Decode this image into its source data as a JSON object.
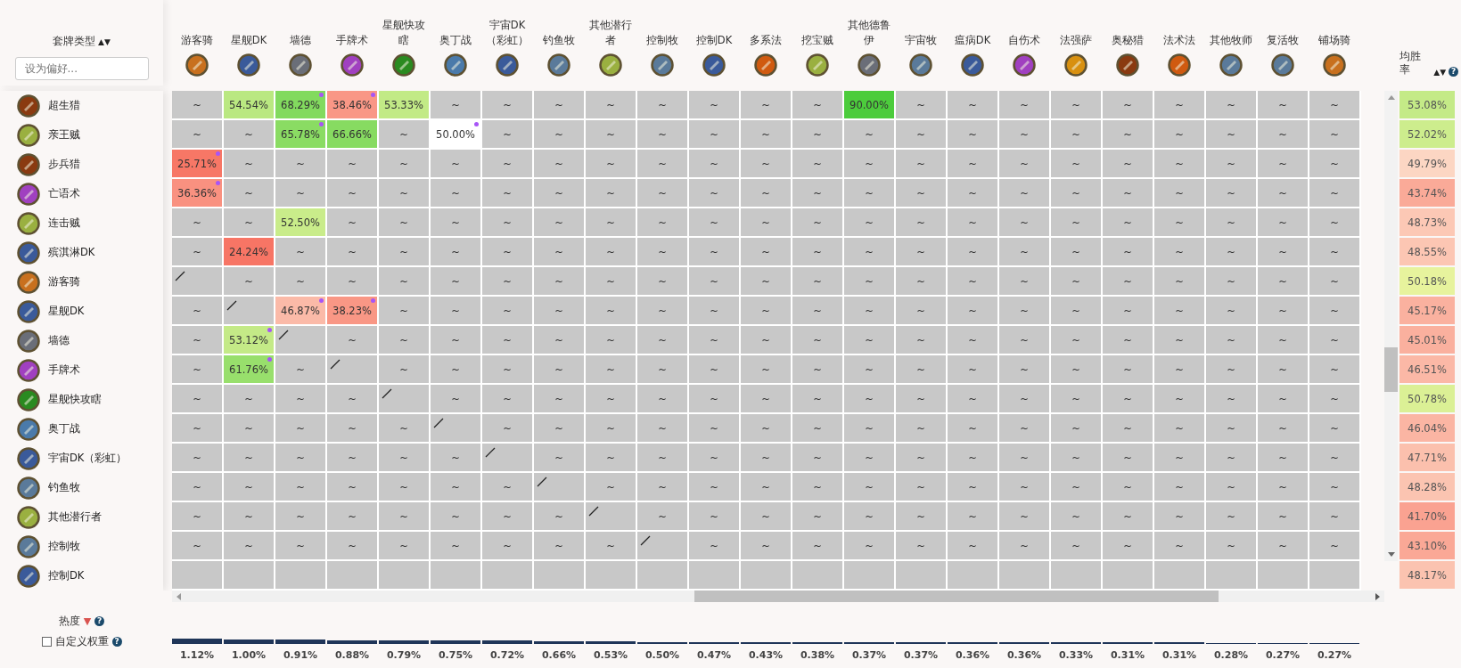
{
  "sidebar": {
    "title": "套牌类型",
    "sort_icon": "▲▼",
    "search": {
      "placeholder": "设为偏好..."
    },
    "popularity_label": "热度",
    "popularity_sort": "▼",
    "popularity_help": "?",
    "custom_weight": {
      "label": "自定义权重",
      "checked": false,
      "help": "?"
    }
  },
  "win_rate_header": {
    "label": "均胜率",
    "sort_icon": "▲▼",
    "help": "?"
  },
  "columns": [
    {
      "name": "游客骑",
      "color": "#c8701e",
      "popularity": "1.12%"
    },
    {
      "name": "星舰DK",
      "color": "#3a5a9a",
      "popularity": "1.00%"
    },
    {
      "name": "墙德",
      "color": "#6a6e78",
      "popularity": "0.91%"
    },
    {
      "name": "手牌术",
      "color": "#a040c0",
      "popularity": "0.88%"
    },
    {
      "name": "星舰快攻瞎",
      "color": "#2a8a20",
      "popularity": "0.79%"
    },
    {
      "name": "奥丁战",
      "color": "#4a7aaa",
      "popularity": "0.75%"
    },
    {
      "name": "宇宙DK（彩虹）",
      "color": "#3a5a9a",
      "popularity": "0.72%"
    },
    {
      "name": "钓鱼牧",
      "color": "#5a7a9a",
      "popularity": "0.66%"
    },
    {
      "name": "其他潜行者",
      "color": "#9ab040",
      "popularity": "0.53%"
    },
    {
      "name": "控制牧",
      "color": "#5a7a9a",
      "popularity": "0.50%"
    },
    {
      "name": "控制DK",
      "color": "#3a5a9a",
      "popularity": "0.47%"
    },
    {
      "name": "多系法",
      "color": "#d05a10",
      "popularity": "0.43%"
    },
    {
      "name": "挖宝贼",
      "color": "#9ab040",
      "popularity": "0.38%"
    },
    {
      "name": "其他德鲁伊",
      "color": "#6a6e78",
      "popularity": "0.37%"
    },
    {
      "name": "宇宙牧",
      "color": "#5a7a9a",
      "popularity": "0.37%"
    },
    {
      "name": "瘟病DK",
      "color": "#3a5a9a",
      "popularity": "0.36%"
    },
    {
      "name": "自伤术",
      "color": "#a040c0",
      "popularity": "0.36%"
    },
    {
      "name": "法强萨",
      "color": "#d89010",
      "popularity": "0.33%"
    },
    {
      "name": "奥秘猎",
      "color": "#8a3a10",
      "popularity": "0.31%"
    },
    {
      "name": "法术法",
      "color": "#d05a10",
      "popularity": "0.31%"
    },
    {
      "name": "其他牧师",
      "color": "#5a7a9a",
      "popularity": "0.28%"
    },
    {
      "name": "复活牧",
      "color": "#5a7a9a",
      "popularity": "0.27%"
    },
    {
      "name": "铺场骑",
      "color": "#c8701e",
      "popularity": "0.27%"
    }
  ],
  "rows": [
    {
      "name": "超生猎",
      "color": "#8a3a10",
      "win_rate": "53.08%",
      "cells": [
        {
          "text": "~",
          "dot": false
        },
        {
          "text": "54.54%",
          "dot": false
        },
        {
          "text": "68.29%",
          "dot": true
        },
        {
          "text": "38.46%",
          "dot": true
        },
        {
          "text": "53.33%",
          "dot": false
        },
        {
          "text": "~",
          "dot": false
        },
        {
          "text": "~",
          "dot": false
        },
        {
          "text": "~",
          "dot": false
        },
        {
          "text": "~",
          "dot": false
        },
        {
          "text": "~",
          "dot": false
        },
        {
          "text": "~",
          "dot": false
        },
        {
          "text": "~",
          "dot": false
        },
        {
          "text": "~",
          "dot": false
        },
        {
          "text": "90.00%",
          "dot": false
        },
        {
          "text": "~",
          "dot": false
        },
        {
          "text": "~",
          "dot": false
        },
        {
          "text": "~",
          "dot": false
        },
        {
          "text": "~",
          "dot": false
        },
        {
          "text": "~",
          "dot": false
        },
        {
          "text": "~",
          "dot": false
        },
        {
          "text": "~",
          "dot": false
        },
        {
          "text": "~",
          "dot": false
        },
        {
          "text": "~",
          "dot": false
        }
      ]
    },
    {
      "name": "亲王贼",
      "color": "#9ab040",
      "win_rate": "52.02%",
      "cells": [
        {
          "text": "~",
          "dot": false
        },
        {
          "text": "~",
          "dot": false
        },
        {
          "text": "65.78%",
          "dot": true
        },
        {
          "text": "66.66%",
          "dot": false
        },
        {
          "text": "~",
          "dot": false
        },
        {
          "text": "50.00%",
          "dot": true
        },
        {
          "text": "~",
          "dot": false
        },
        {
          "text": "~",
          "dot": false
        },
        {
          "text": "~",
          "dot": false
        },
        {
          "text": "~",
          "dot": false
        },
        {
          "text": "~",
          "dot": false
        },
        {
          "text": "~",
          "dot": false
        },
        {
          "text": "~",
          "dot": false
        },
        {
          "text": "~",
          "dot": false
        },
        {
          "text": "~",
          "dot": false
        },
        {
          "text": "~",
          "dot": false
        },
        {
          "text": "~",
          "dot": false
        },
        {
          "text": "~",
          "dot": false
        },
        {
          "text": "~",
          "dot": false
        },
        {
          "text": "~",
          "dot": false
        },
        {
          "text": "~",
          "dot": false
        },
        {
          "text": "~",
          "dot": false
        },
        {
          "text": "~",
          "dot": false
        }
      ]
    },
    {
      "name": "步兵猎",
      "color": "#8a3a10",
      "win_rate": "49.79%",
      "cells": [
        {
          "text": "25.71%",
          "dot": true
        },
        {
          "text": "~",
          "dot": false
        },
        {
          "text": "~",
          "dot": false
        },
        {
          "text": "~",
          "dot": false
        },
        {
          "text": "~",
          "dot": false
        },
        {
          "text": "~",
          "dot": false
        },
        {
          "text": "~",
          "dot": false
        },
        {
          "text": "~",
          "dot": false
        },
        {
          "text": "~",
          "dot": false
        },
        {
          "text": "~",
          "dot": false
        },
        {
          "text": "~",
          "dot": false
        },
        {
          "text": "~",
          "dot": false
        },
        {
          "text": "~",
          "dot": false
        },
        {
          "text": "~",
          "dot": false
        },
        {
          "text": "~",
          "dot": false
        },
        {
          "text": "~",
          "dot": false
        },
        {
          "text": "~",
          "dot": false
        },
        {
          "text": "~",
          "dot": false
        },
        {
          "text": "~",
          "dot": false
        },
        {
          "text": "~",
          "dot": false
        },
        {
          "text": "~",
          "dot": false
        },
        {
          "text": "~",
          "dot": false
        },
        {
          "text": "~",
          "dot": false
        }
      ]
    },
    {
      "name": "亡语术",
      "color": "#a040c0",
      "win_rate": "43.74%",
      "cells": [
        {
          "text": "36.36%",
          "dot": true
        },
        {
          "text": "~",
          "dot": false
        },
        {
          "text": "~",
          "dot": false
        },
        {
          "text": "~",
          "dot": false
        },
        {
          "text": "~",
          "dot": false
        },
        {
          "text": "~",
          "dot": false
        },
        {
          "text": "~",
          "dot": false
        },
        {
          "text": "~",
          "dot": false
        },
        {
          "text": "~",
          "dot": false
        },
        {
          "text": "~",
          "dot": false
        },
        {
          "text": "~",
          "dot": false
        },
        {
          "text": "~",
          "dot": false
        },
        {
          "text": "~",
          "dot": false
        },
        {
          "text": "~",
          "dot": false
        },
        {
          "text": "~",
          "dot": false
        },
        {
          "text": "~",
          "dot": false
        },
        {
          "text": "~",
          "dot": false
        },
        {
          "text": "~",
          "dot": false
        },
        {
          "text": "~",
          "dot": false
        },
        {
          "text": "~",
          "dot": false
        },
        {
          "text": "~",
          "dot": false
        },
        {
          "text": "~",
          "dot": false
        },
        {
          "text": "~",
          "dot": false
        }
      ]
    },
    {
      "name": "连击贼",
      "color": "#9ab040",
      "win_rate": "48.73%",
      "cells": [
        {
          "text": "~",
          "dot": false
        },
        {
          "text": "~",
          "dot": false
        },
        {
          "text": "52.50%",
          "dot": false
        },
        {
          "text": "~",
          "dot": false
        },
        {
          "text": "~",
          "dot": false
        },
        {
          "text": "~",
          "dot": false
        },
        {
          "text": "~",
          "dot": false
        },
        {
          "text": "~",
          "dot": false
        },
        {
          "text": "~",
          "dot": false
        },
        {
          "text": "~",
          "dot": false
        },
        {
          "text": "~",
          "dot": false
        },
        {
          "text": "~",
          "dot": false
        },
        {
          "text": "~",
          "dot": false
        },
        {
          "text": "~",
          "dot": false
        },
        {
          "text": "~",
          "dot": false
        },
        {
          "text": "~",
          "dot": false
        },
        {
          "text": "~",
          "dot": false
        },
        {
          "text": "~",
          "dot": false
        },
        {
          "text": "~",
          "dot": false
        },
        {
          "text": "~",
          "dot": false
        },
        {
          "text": "~",
          "dot": false
        },
        {
          "text": "~",
          "dot": false
        },
        {
          "text": "~",
          "dot": false
        }
      ]
    },
    {
      "name": "殡淇淋DK",
      "color": "#3a5a9a",
      "win_rate": "48.55%",
      "cells": [
        {
          "text": "~",
          "dot": false
        },
        {
          "text": "24.24%",
          "dot": false
        },
        {
          "text": "~",
          "dot": false
        },
        {
          "text": "~",
          "dot": false
        },
        {
          "text": "~",
          "dot": false
        },
        {
          "text": "~",
          "dot": false
        },
        {
          "text": "~",
          "dot": false
        },
        {
          "text": "~",
          "dot": false
        },
        {
          "text": "~",
          "dot": false
        },
        {
          "text": "~",
          "dot": false
        },
        {
          "text": "~",
          "dot": false
        },
        {
          "text": "~",
          "dot": false
        },
        {
          "text": "~",
          "dot": false
        },
        {
          "text": "~",
          "dot": false
        },
        {
          "text": "~",
          "dot": false
        },
        {
          "text": "~",
          "dot": false
        },
        {
          "text": "~",
          "dot": false
        },
        {
          "text": "~",
          "dot": false
        },
        {
          "text": "~",
          "dot": false
        },
        {
          "text": "~",
          "dot": false
        },
        {
          "text": "~",
          "dot": false
        },
        {
          "text": "~",
          "dot": false
        },
        {
          "text": "~",
          "dot": false
        }
      ]
    },
    {
      "name": "游客骑",
      "color": "#c8701e",
      "win_rate": "50.18%",
      "cells": [
        {
          "kind": "mirror",
          "dot": false
        },
        {
          "text": "~",
          "dot": false
        },
        {
          "text": "~",
          "dot": false
        },
        {
          "text": "~",
          "dot": false
        },
        {
          "text": "~",
          "dot": false
        },
        {
          "text": "~",
          "dot": false
        },
        {
          "text": "~",
          "dot": false
        },
        {
          "text": "~",
          "dot": false
        },
        {
          "text": "~",
          "dot": false
        },
        {
          "text": "~",
          "dot": false
        },
        {
          "text": "~",
          "dot": false
        },
        {
          "text": "~",
          "dot": false
        },
        {
          "text": "~",
          "dot": false
        },
        {
          "text": "~",
          "dot": false
        },
        {
          "text": "~",
          "dot": false
        },
        {
          "text": "~",
          "dot": false
        },
        {
          "text": "~",
          "dot": false
        },
        {
          "text": "~",
          "dot": false
        },
        {
          "text": "~",
          "dot": false
        },
        {
          "text": "~",
          "dot": false
        },
        {
          "text": "~",
          "dot": false
        },
        {
          "text": "~",
          "dot": false
        },
        {
          "text": "~",
          "dot": false
        }
      ]
    },
    {
      "name": "星舰DK",
      "color": "#3a5a9a",
      "win_rate": "45.17%",
      "cells": [
        {
          "text": "~",
          "dot": false
        },
        {
          "kind": "mirror",
          "dot": false
        },
        {
          "text": "46.87%",
          "dot": true
        },
        {
          "text": "38.23%",
          "dot": true
        },
        {
          "text": "~",
          "dot": false
        },
        {
          "text": "~",
          "dot": false
        },
        {
          "text": "~",
          "dot": false
        },
        {
          "text": "~",
          "dot": false
        },
        {
          "text": "~",
          "dot": false
        },
        {
          "text": "~",
          "dot": false
        },
        {
          "text": "~",
          "dot": false
        },
        {
          "text": "~",
          "dot": false
        },
        {
          "text": "~",
          "dot": false
        },
        {
          "text": "~",
          "dot": false
        },
        {
          "text": "~",
          "dot": false
        },
        {
          "text": "~",
          "dot": false
        },
        {
          "text": "~",
          "dot": false
        },
        {
          "text": "~",
          "dot": false
        },
        {
          "text": "~",
          "dot": false
        },
        {
          "text": "~",
          "dot": false
        },
        {
          "text": "~",
          "dot": false
        },
        {
          "text": "~",
          "dot": false
        },
        {
          "text": "~",
          "dot": false
        }
      ]
    },
    {
      "name": "墙德",
      "color": "#6a6e78",
      "win_rate": "45.01%",
      "cells": [
        {
          "text": "~",
          "dot": false
        },
        {
          "text": "53.12%",
          "dot": true
        },
        {
          "kind": "mirror",
          "dot": false
        },
        {
          "text": "~",
          "dot": false
        },
        {
          "text": "~",
          "dot": false
        },
        {
          "text": "~",
          "dot": false
        },
        {
          "text": "~",
          "dot": false
        },
        {
          "text": "~",
          "dot": false
        },
        {
          "text": "~",
          "dot": false
        },
        {
          "text": "~",
          "dot": false
        },
        {
          "text": "~",
          "dot": false
        },
        {
          "text": "~",
          "dot": false
        },
        {
          "text": "~",
          "dot": false
        },
        {
          "text": "~",
          "dot": false
        },
        {
          "text": "~",
          "dot": false
        },
        {
          "text": "~",
          "dot": false
        },
        {
          "text": "~",
          "dot": false
        },
        {
          "text": "~",
          "dot": false
        },
        {
          "text": "~",
          "dot": false
        },
        {
          "text": "~",
          "dot": false
        },
        {
          "text": "~",
          "dot": false
        },
        {
          "text": "~",
          "dot": false
        },
        {
          "text": "~",
          "dot": false
        }
      ]
    },
    {
      "name": "手牌术",
      "color": "#a040c0",
      "win_rate": "46.51%",
      "cells": [
        {
          "text": "~",
          "dot": false
        },
        {
          "text": "61.76%",
          "dot": true
        },
        {
          "text": "~",
          "dot": false
        },
        {
          "kind": "mirror",
          "dot": false
        },
        {
          "text": "~",
          "dot": false
        },
        {
          "text": "~",
          "dot": false
        },
        {
          "text": "~",
          "dot": false
        },
        {
          "text": "~",
          "dot": false
        },
        {
          "text": "~",
          "dot": false
        },
        {
          "text": "~",
          "dot": false
        },
        {
          "text": "~",
          "dot": false
        },
        {
          "text": "~",
          "dot": false
        },
        {
          "text": "~",
          "dot": false
        },
        {
          "text": "~",
          "dot": false
        },
        {
          "text": "~",
          "dot": false
        },
        {
          "text": "~",
          "dot": false
        },
        {
          "text": "~",
          "dot": false
        },
        {
          "text": "~",
          "dot": false
        },
        {
          "text": "~",
          "dot": false
        },
        {
          "text": "~",
          "dot": false
        },
        {
          "text": "~",
          "dot": false
        },
        {
          "text": "~",
          "dot": false
        },
        {
          "text": "~",
          "dot": false
        }
      ]
    },
    {
      "name": "星舰快攻瞎",
      "color": "#2a8a20",
      "win_rate": "50.78%",
      "cells": [
        {
          "text": "~",
          "dot": false
        },
        {
          "text": "~",
          "dot": false
        },
        {
          "text": "~",
          "dot": false
        },
        {
          "text": "~",
          "dot": false
        },
        {
          "kind": "mirror",
          "dot": false
        },
        {
          "text": "~",
          "dot": false
        },
        {
          "text": "~",
          "dot": false
        },
        {
          "text": "~",
          "dot": false
        },
        {
          "text": "~",
          "dot": false
        },
        {
          "text": "~",
          "dot": false
        },
        {
          "text": "~",
          "dot": false
        },
        {
          "text": "~",
          "dot": false
        },
        {
          "text": "~",
          "dot": false
        },
        {
          "text": "~",
          "dot": false
        },
        {
          "text": "~",
          "dot": false
        },
        {
          "text": "~",
          "dot": false
        },
        {
          "text": "~",
          "dot": false
        },
        {
          "text": "~",
          "dot": false
        },
        {
          "text": "~",
          "dot": false
        },
        {
          "text": "~",
          "dot": false
        },
        {
          "text": "~",
          "dot": false
        },
        {
          "text": "~",
          "dot": false
        },
        {
          "text": "~",
          "dot": false
        }
      ]
    },
    {
      "name": "奥丁战",
      "color": "#4a7aaa",
      "win_rate": "46.04%",
      "cells": [
        {
          "text": "~",
          "dot": false
        },
        {
          "text": "~",
          "dot": false
        },
        {
          "text": "~",
          "dot": false
        },
        {
          "text": "~",
          "dot": false
        },
        {
          "text": "~",
          "dot": false
        },
        {
          "kind": "mirror",
          "dot": false
        },
        {
          "text": "~",
          "dot": false
        },
        {
          "text": "~",
          "dot": false
        },
        {
          "text": "~",
          "dot": false
        },
        {
          "text": "~",
          "dot": false
        },
        {
          "text": "~",
          "dot": false
        },
        {
          "text": "~",
          "dot": false
        },
        {
          "text": "~",
          "dot": false
        },
        {
          "text": "~",
          "dot": false
        },
        {
          "text": "~",
          "dot": false
        },
        {
          "text": "~",
          "dot": false
        },
        {
          "text": "~",
          "dot": false
        },
        {
          "text": "~",
          "dot": false
        },
        {
          "text": "~",
          "dot": false
        },
        {
          "text": "~",
          "dot": false
        },
        {
          "text": "~",
          "dot": false
        },
        {
          "text": "~",
          "dot": false
        },
        {
          "text": "~",
          "dot": false
        }
      ]
    },
    {
      "name": "宇宙DK（彩虹）",
      "color": "#3a5a9a",
      "win_rate": "47.71%",
      "cells": [
        {
          "text": "~",
          "dot": false
        },
        {
          "text": "~",
          "dot": false
        },
        {
          "text": "~",
          "dot": false
        },
        {
          "text": "~",
          "dot": false
        },
        {
          "text": "~",
          "dot": false
        },
        {
          "text": "~",
          "dot": false
        },
        {
          "kind": "mirror",
          "dot": false
        },
        {
          "text": "~",
          "dot": false
        },
        {
          "text": "~",
          "dot": false
        },
        {
          "text": "~",
          "dot": false
        },
        {
          "text": "~",
          "dot": false
        },
        {
          "text": "~",
          "dot": false
        },
        {
          "text": "~",
          "dot": false
        },
        {
          "text": "~",
          "dot": false
        },
        {
          "text": "~",
          "dot": false
        },
        {
          "text": "~",
          "dot": false
        },
        {
          "text": "~",
          "dot": false
        },
        {
          "text": "~",
          "dot": false
        },
        {
          "text": "~",
          "dot": false
        },
        {
          "text": "~",
          "dot": false
        },
        {
          "text": "~",
          "dot": false
        },
        {
          "text": "~",
          "dot": false
        },
        {
          "text": "~",
          "dot": false
        }
      ]
    },
    {
      "name": "钓鱼牧",
      "color": "#5a7a9a",
      "win_rate": "48.28%",
      "cells": [
        {
          "text": "~",
          "dot": false
        },
        {
          "text": "~",
          "dot": false
        },
        {
          "text": "~",
          "dot": false
        },
        {
          "text": "~",
          "dot": false
        },
        {
          "text": "~",
          "dot": false
        },
        {
          "text": "~",
          "dot": false
        },
        {
          "text": "~",
          "dot": false
        },
        {
          "kind": "mirror",
          "dot": false
        },
        {
          "text": "~",
          "dot": false
        },
        {
          "text": "~",
          "dot": false
        },
        {
          "text": "~",
          "dot": false
        },
        {
          "text": "~",
          "dot": false
        },
        {
          "text": "~",
          "dot": false
        },
        {
          "text": "~",
          "dot": false
        },
        {
          "text": "~",
          "dot": false
        },
        {
          "text": "~",
          "dot": false
        },
        {
          "text": "~",
          "dot": false
        },
        {
          "text": "~",
          "dot": false
        },
        {
          "text": "~",
          "dot": false
        },
        {
          "text": "~",
          "dot": false
        },
        {
          "text": "~",
          "dot": false
        },
        {
          "text": "~",
          "dot": false
        },
        {
          "text": "~",
          "dot": false
        }
      ]
    },
    {
      "name": "其他潜行者",
      "color": "#9ab040",
      "win_rate": "41.70%",
      "cells": [
        {
          "text": "~",
          "dot": false
        },
        {
          "text": "~",
          "dot": false
        },
        {
          "text": "~",
          "dot": false
        },
        {
          "text": "~",
          "dot": false
        },
        {
          "text": "~",
          "dot": false
        },
        {
          "text": "~",
          "dot": false
        },
        {
          "text": "~",
          "dot": false
        },
        {
          "text": "~",
          "dot": false
        },
        {
          "kind": "mirror",
          "dot": false
        },
        {
          "text": "~",
          "dot": false
        },
        {
          "text": "~",
          "dot": false
        },
        {
          "text": "~",
          "dot": false
        },
        {
          "text": "~",
          "dot": false
        },
        {
          "text": "~",
          "dot": false
        },
        {
          "text": "~",
          "dot": false
        },
        {
          "text": "~",
          "dot": false
        },
        {
          "text": "~",
          "dot": false
        },
        {
          "text": "~",
          "dot": false
        },
        {
          "text": "~",
          "dot": false
        },
        {
          "text": "~",
          "dot": false
        },
        {
          "text": "~",
          "dot": false
        },
        {
          "text": "~",
          "dot": false
        },
        {
          "text": "~",
          "dot": false
        }
      ]
    },
    {
      "name": "控制牧",
      "color": "#5a7a9a",
      "win_rate": "43.10%",
      "cells": [
        {
          "text": "~",
          "dot": false
        },
        {
          "text": "~",
          "dot": false
        },
        {
          "text": "~",
          "dot": false
        },
        {
          "text": "~",
          "dot": false
        },
        {
          "text": "~",
          "dot": false
        },
        {
          "text": "~",
          "dot": false
        },
        {
          "text": "~",
          "dot": false
        },
        {
          "text": "~",
          "dot": false
        },
        {
          "text": "~",
          "dot": false
        },
        {
          "kind": "mirror",
          "dot": false
        },
        {
          "text": "~",
          "dot": false
        },
        {
          "text": "~",
          "dot": false
        },
        {
          "text": "~",
          "dot": false
        },
        {
          "text": "~",
          "dot": false
        },
        {
          "text": "~",
          "dot": false
        },
        {
          "text": "~",
          "dot": false
        },
        {
          "text": "~",
          "dot": false
        },
        {
          "text": "~",
          "dot": false
        },
        {
          "text": "~",
          "dot": false
        },
        {
          "text": "~",
          "dot": false
        },
        {
          "text": "~",
          "dot": false
        },
        {
          "text": "~",
          "dot": false
        },
        {
          "text": "~",
          "dot": false
        }
      ]
    },
    {
      "name": "控制DK",
      "color": "#3a5a9a",
      "win_rate": "48.17%"
    }
  ]
}
